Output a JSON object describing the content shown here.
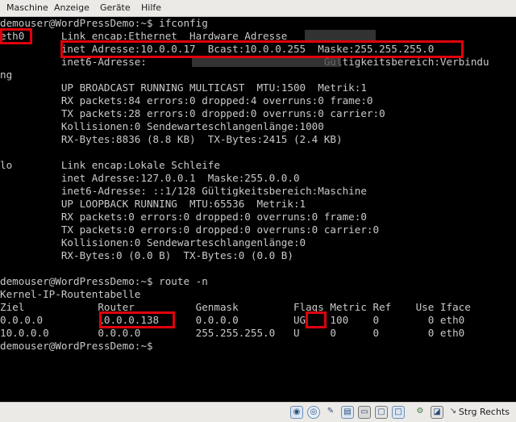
{
  "menubar": {
    "items": [
      "Maschine",
      "Anzeige",
      "Geräte",
      "Hilfe"
    ]
  },
  "terminal": {
    "lines": [
      "demouser@WordPressDemo:~$ ifconfig",
      "eth0      Link encap:Ethernet  Hardware Adresse",
      "          inet Adresse:10.0.0.17  Bcast:10.0.0.255  Maske:255.255.255.0",
      "          inet6-Adresse:                             Gültigkeitsbereich:Verbindu",
      "ng",
      "          UP BROADCAST RUNNING MULTICAST  MTU:1500  Metrik:1",
      "          RX packets:84 errors:0 dropped:4 overruns:0 frame:0",
      "          TX packets:28 errors:0 dropped:0 overruns:0 carrier:0",
      "          Kollisionen:0 Sendewarteschlangenlänge:1000",
      "          RX-Bytes:8836 (8.8 KB)  TX-Bytes:2415 (2.4 KB)",
      "",
      "lo        Link encap:Lokale Schleife",
      "          inet Adresse:127.0.0.1  Maske:255.0.0.0",
      "          inet6-Adresse: ::1/128 Gültigkeitsbereich:Maschine",
      "          UP LOOPBACK RUNNING  MTU:65536  Metrik:1",
      "          RX packets:0 errors:0 dropped:0 overruns:0 frame:0",
      "          TX packets:0 errors:0 dropped:0 overruns:0 carrier:0",
      "          Kollisionen:0 Sendewarteschlangenlänge:0",
      "          RX-Bytes:0 (0.0 B)  TX-Bytes:0 (0.0 B)",
      "",
      "demouser@WordPressDemo:~$ route -n",
      "Kernel-IP-Routentabelle",
      "Ziel            Router          Genmask         Flags Metric Ref    Use Iface",
      "0.0.0.0         10.0.0.138      0.0.0.0         UG    100    0        0 eth0",
      "10.0.0.0        0.0.0.0         255.255.255.0   U     0      0        0 eth0",
      "demouser@WordPressDemo:~$"
    ]
  },
  "colors": {
    "highlight": "#e0000c",
    "terminal_bg": "#000000",
    "terminal_fg": "#c9c9c9"
  },
  "statusbar": {
    "icons": [
      "hard-disk-icon",
      "optical-drive-icon",
      "usb-icon",
      "shared-folders-icon",
      "display-icon",
      "video-capture-icon",
      "network-icon",
      "cpu-virtualization-icon",
      "mouse-integration-icon",
      "host-key-arrow-icon"
    ],
    "host_key_label": "Strg Rechts"
  }
}
